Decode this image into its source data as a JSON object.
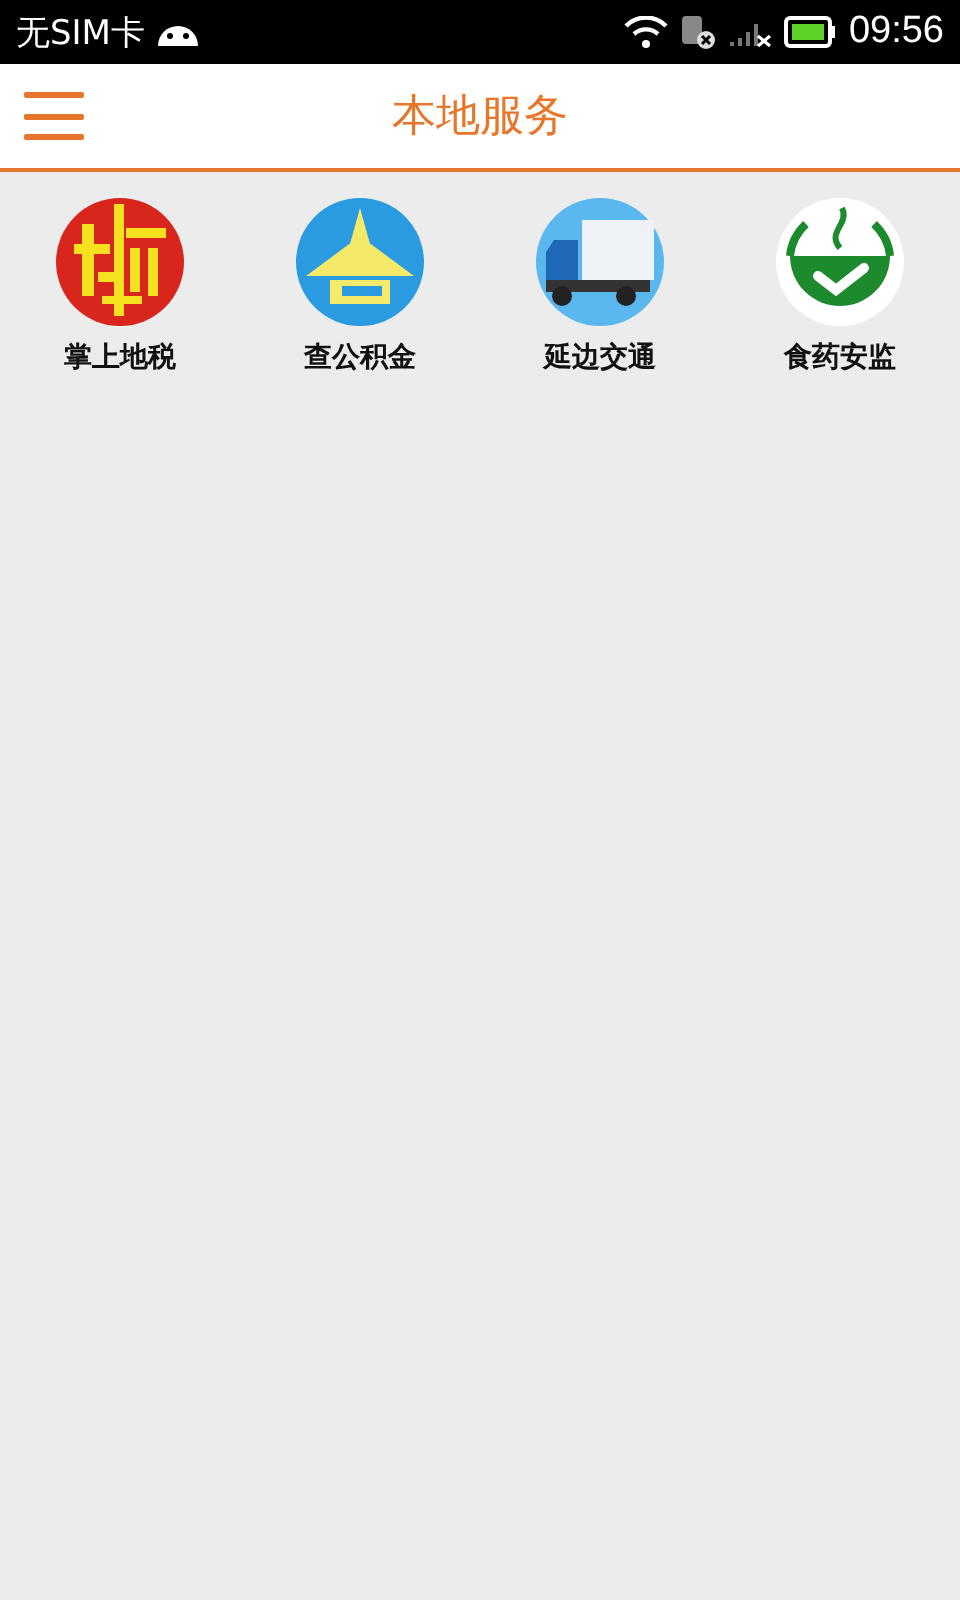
{
  "status_bar": {
    "carrier": "无SIM卡",
    "time": "09:56"
  },
  "header": {
    "title": "本地服务"
  },
  "services": [
    {
      "kind": "tax",
      "label": "掌上地税"
    },
    {
      "kind": "fund",
      "label": "查公积金"
    },
    {
      "kind": "truck",
      "label": "延边交通"
    },
    {
      "kind": "food",
      "label": "食药安监"
    }
  ]
}
